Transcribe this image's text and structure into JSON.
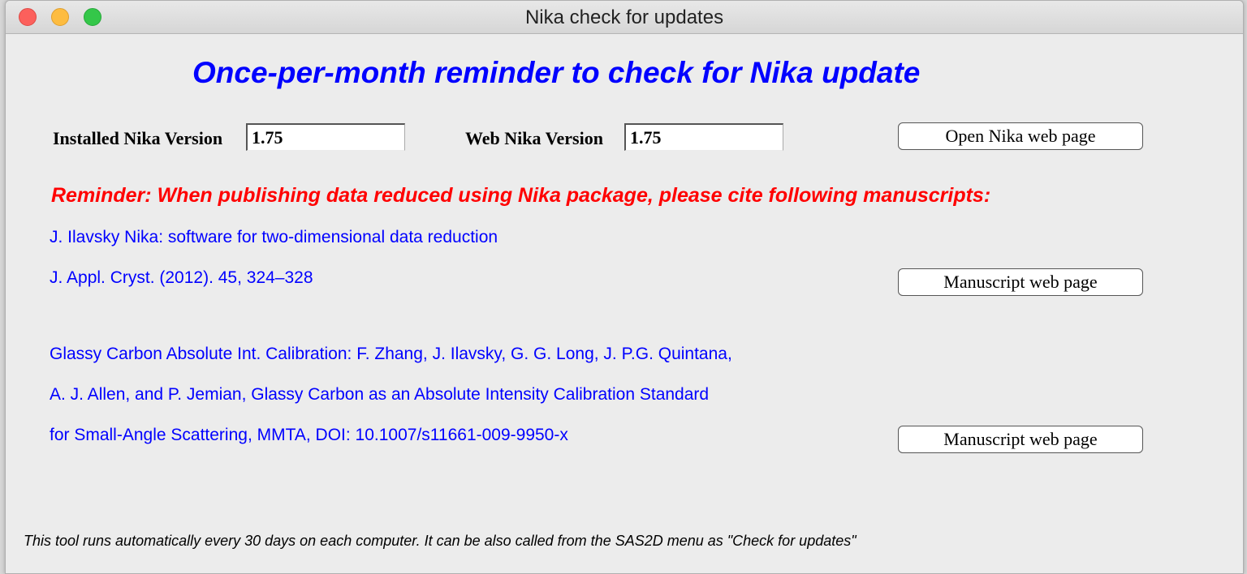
{
  "window": {
    "title": "Nika check for updates"
  },
  "heading": "Once-per-month reminder to check for Nika update",
  "versions": {
    "installed_label": "Installed Nika Version",
    "installed_value": "1.75",
    "web_label": "Web Nika Version",
    "web_value": "1.75"
  },
  "buttons": {
    "open_nika": "Open Nika web page",
    "manuscript_1": "Manuscript web page",
    "manuscript_2": "Manuscript web page"
  },
  "reminder": "Reminder: When publishing data reduced using Nika package, please cite following manuscripts:",
  "citations": {
    "nika_line1": "J. Ilavsky Nika: software for two-dimensional data reduction",
    "nika_line2": "J. Appl. Cryst. (2012). 45, 324–328",
    "gc_line1": "Glassy Carbon Absolute Int. Calibration: F. Zhang, J. Ilavsky, G. G. Long, J. P.G. Quintana,",
    "gc_line2": "A. J. Allen, and P. Jemian, Glassy Carbon as an Absolute Intensity Calibration Standard",
    "gc_line3": "for Small-Angle Scattering, MMTA, DOI: 10.1007/s11661-009-9950-x"
  },
  "footer": "This tool runs automatically every 30 days on each computer. It can be also called from the SAS2D menu as \"Check for updates\"",
  "colors": {
    "heading": "#0000ff",
    "reminder": "#ff0000",
    "citation": "#0000ff"
  }
}
